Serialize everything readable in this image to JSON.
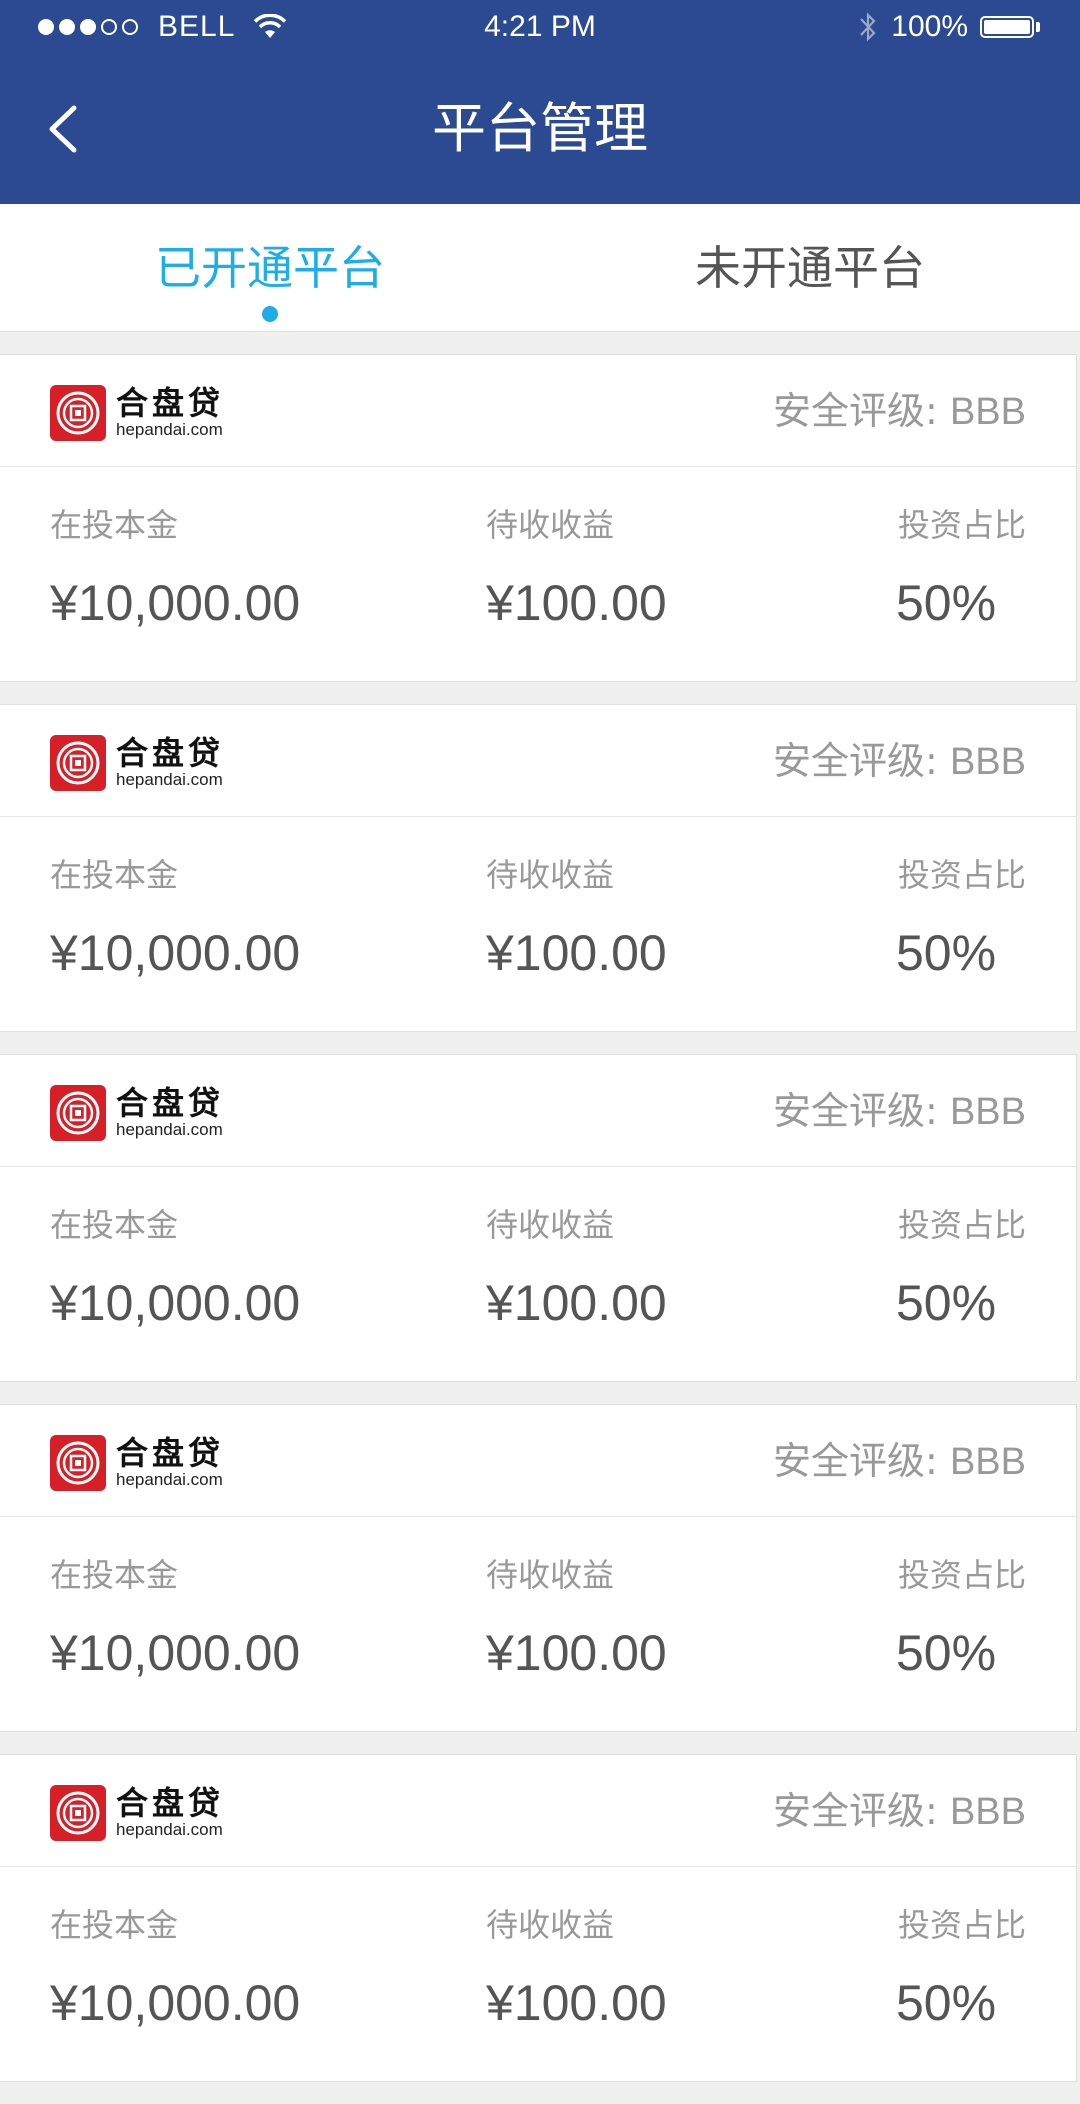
{
  "status_bar": {
    "carrier": "BELL",
    "time": "4:21 PM",
    "battery": "100%"
  },
  "header": {
    "title": "平台管理"
  },
  "tabs": [
    {
      "label": "已开通平台",
      "active": true
    },
    {
      "label": "未开通平台",
      "active": false
    }
  ],
  "colors": {
    "header_bg": "#2b4a92",
    "accent": "#1daee8",
    "logo_red": "#d61f26"
  },
  "cards": [
    {
      "logo_cn": "合盘贷",
      "logo_en": "hepandai.com",
      "rating_label": "安全评级:",
      "rating": "BBB",
      "principal_label": "在投本金",
      "principal": "¥10,000.00",
      "income_label": "待收收益",
      "income": "¥100.00",
      "ratio_label": "投资占比",
      "ratio": "50%"
    },
    {
      "logo_cn": "合盘贷",
      "logo_en": "hepandai.com",
      "rating_label": "安全评级:",
      "rating": "BBB",
      "principal_label": "在投本金",
      "principal": "¥10,000.00",
      "income_label": "待收收益",
      "income": "¥100.00",
      "ratio_label": "投资占比",
      "ratio": "50%"
    },
    {
      "logo_cn": "合盘贷",
      "logo_en": "hepandai.com",
      "rating_label": "安全评级:",
      "rating": "BBB",
      "principal_label": "在投本金",
      "principal": "¥10,000.00",
      "income_label": "待收收益",
      "income": "¥100.00",
      "ratio_label": "投资占比",
      "ratio": "50%"
    },
    {
      "logo_cn": "合盘贷",
      "logo_en": "hepandai.com",
      "rating_label": "安全评级:",
      "rating": "BBB",
      "principal_label": "在投本金",
      "principal": "¥10,000.00",
      "income_label": "待收收益",
      "income": "¥100.00",
      "ratio_label": "投资占比",
      "ratio": "50%"
    },
    {
      "logo_cn": "合盘贷",
      "logo_en": "hepandai.com",
      "rating_label": "安全评级:",
      "rating": "BBB",
      "principal_label": "在投本金",
      "principal": "¥10,000.00",
      "income_label": "待收收益",
      "income": "¥100.00",
      "ratio_label": "投资占比",
      "ratio": "50%"
    }
  ]
}
